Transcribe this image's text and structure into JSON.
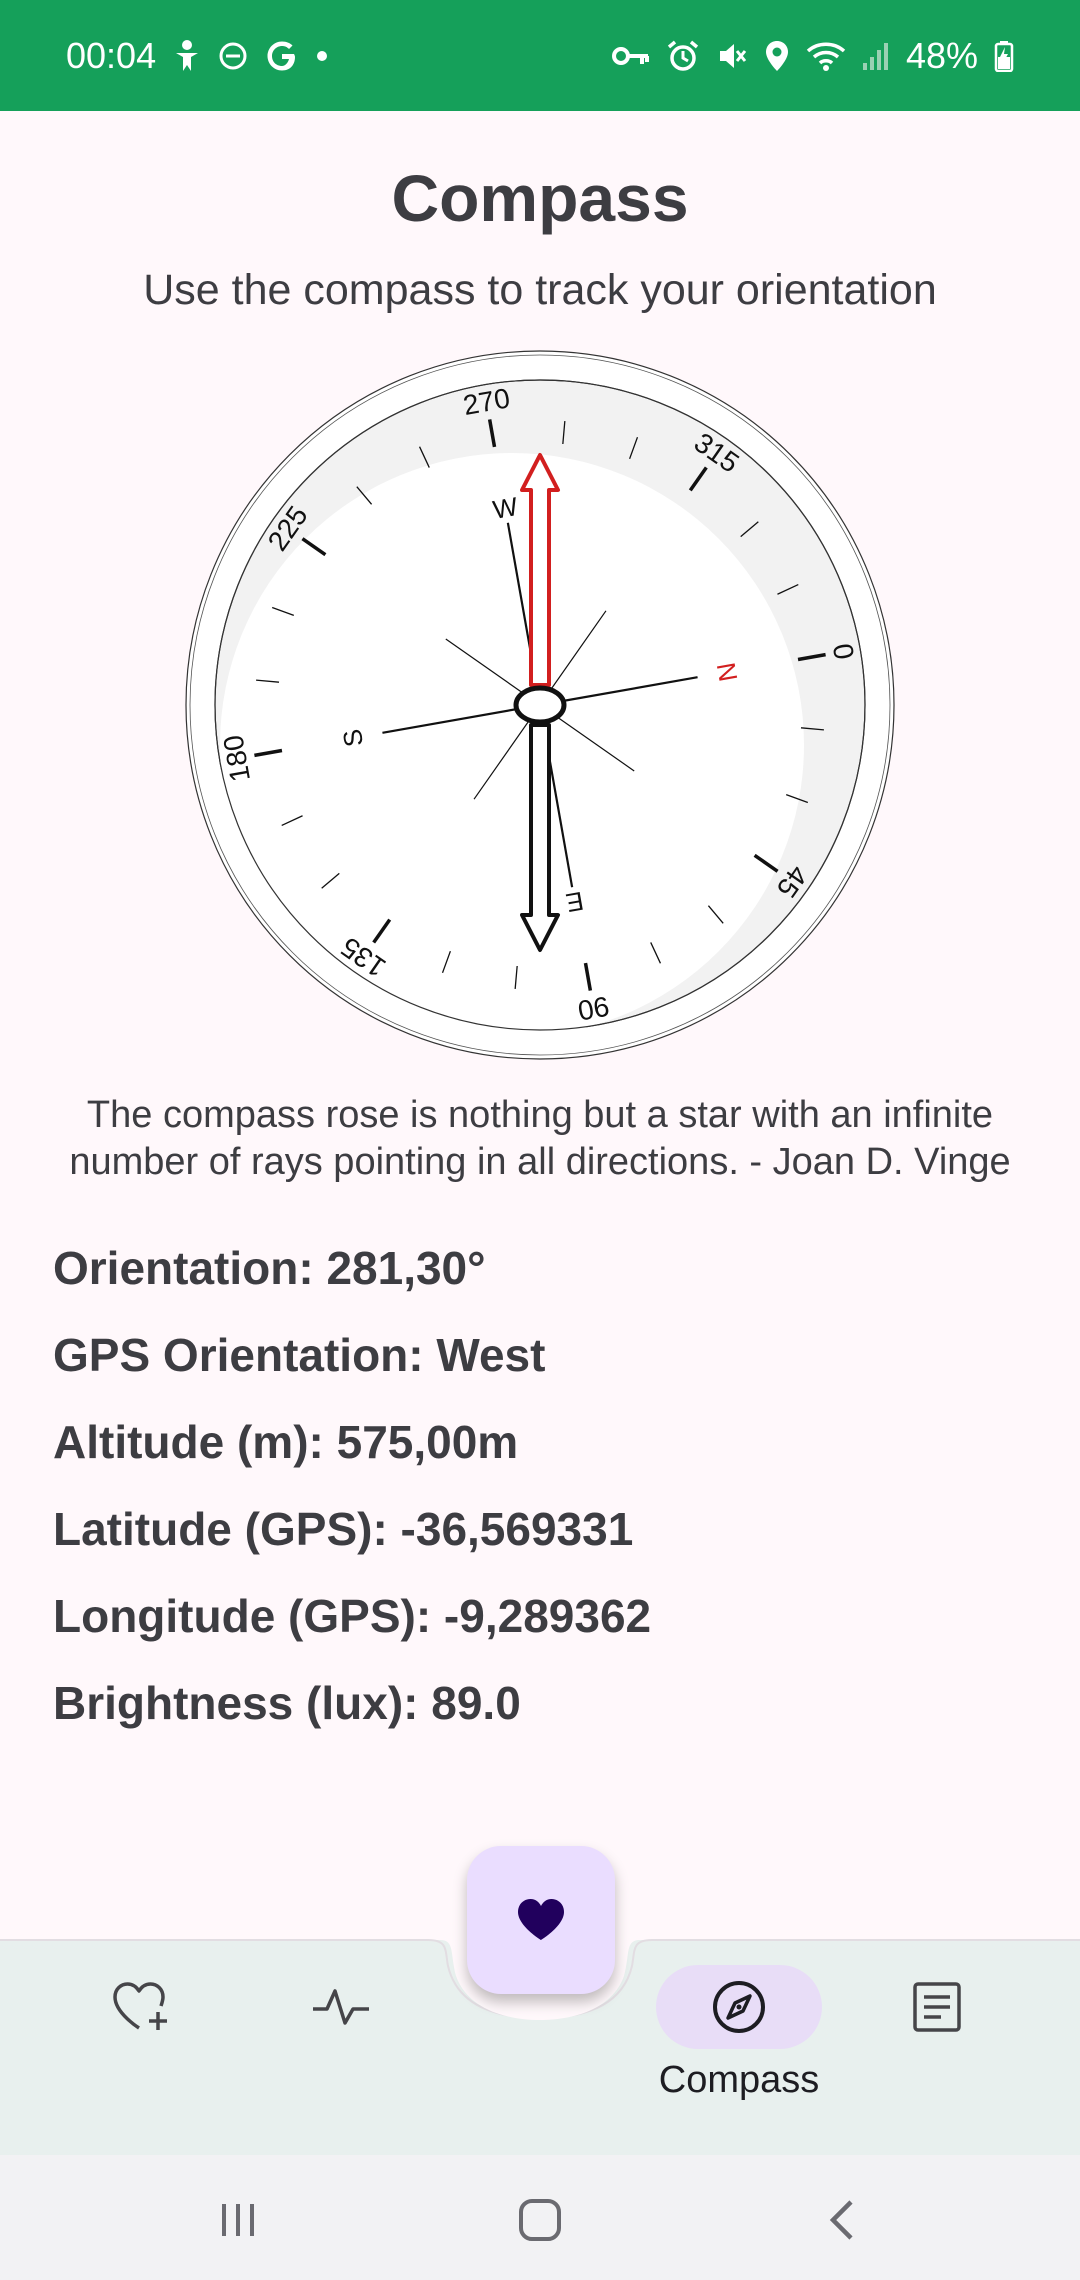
{
  "status_bar": {
    "time": "00:04",
    "battery": "48%",
    "left_icons": [
      "accessibility-icon",
      "dnd-icon",
      "google-icon",
      "dot-icon"
    ],
    "right_icons": [
      "vpn-key-icon",
      "alarm-icon",
      "mute-icon",
      "location-icon",
      "wifi-icon",
      "signal-icon",
      "battery-icon"
    ]
  },
  "header": {
    "title": "Compass",
    "subtitle": "Use the compass to track your orientation"
  },
  "compass": {
    "degree_labels": [
      "0",
      "45",
      "90",
      "135",
      "180",
      "225",
      "270",
      "315"
    ],
    "cardinals": {
      "n": "N",
      "e": "E",
      "s": "S",
      "w": "W"
    },
    "north_color": "#D21F1F",
    "needle_color": "#D21F1F",
    "heading_deg": 281.3
  },
  "quote": "The compass rose is nothing but a star with an infinite number of rays pointing in all directions. - Joan D. Vinge",
  "readouts": {
    "orientation": "Orientation: 281,30°",
    "gps_orientation": "GPS Orientation: West",
    "altitude": "Altitude (m): 575,00m",
    "latitude": "Latitude (GPS): -36,569331",
    "longitude": "Longitude (GPS): -9,289362",
    "brightness": "Brightness (lux): 89.0"
  },
  "bottom_nav": {
    "fab_icon": "heart-icon",
    "items": [
      {
        "icon": "heart-add-icon",
        "label": ""
      },
      {
        "icon": "activity-icon",
        "label": ""
      },
      {
        "icon": "compass-icon",
        "label": "Compass",
        "active": true
      },
      {
        "icon": "notes-icon",
        "label": ""
      }
    ]
  },
  "colors": {
    "status_bar": "#15A05A",
    "background": "#FFF8FB",
    "nav_bar": "#E8F0EE",
    "active_pill": "#E8DDF7",
    "fab": "#EADDFF",
    "fab_icon": "#21005D"
  }
}
